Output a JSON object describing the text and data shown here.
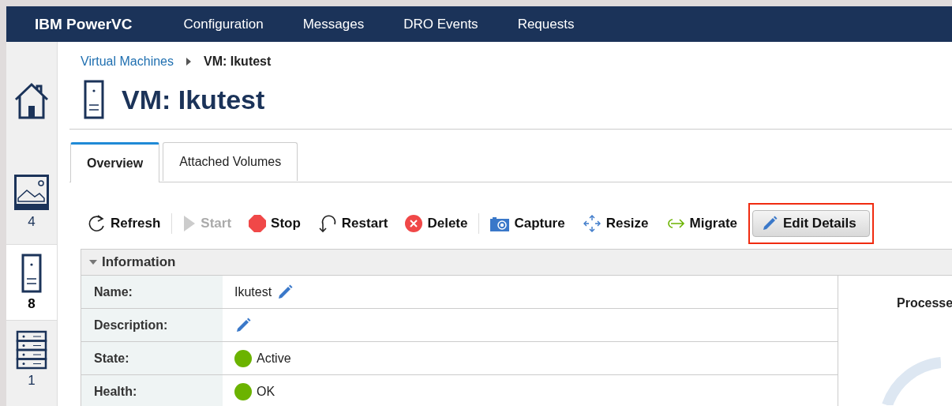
{
  "header": {
    "brand": "IBM PowerVC",
    "nav": [
      {
        "label": "Configuration"
      },
      {
        "label": "Messages"
      },
      {
        "label": "DRO Events"
      },
      {
        "label": "Requests"
      }
    ]
  },
  "sidebar": {
    "items": [
      {
        "kind": "home",
        "selected": false
      },
      {
        "kind": "images",
        "count": "4",
        "selected": false
      },
      {
        "kind": "vms",
        "count": "8",
        "selected": true
      },
      {
        "kind": "hosts",
        "count": "1",
        "selected": false
      }
    ]
  },
  "breadcrumb": {
    "parent": "Virtual Machines",
    "current": "VM: Ikutest"
  },
  "title": "VM: Ikutest",
  "tabs": [
    {
      "label": "Overview",
      "selected": true
    },
    {
      "label": "Attached Volumes",
      "selected": false
    }
  ],
  "toolbar": [
    [
      {
        "kind": "refresh",
        "label": "Refresh",
        "disabled": false,
        "highlighted": false
      }
    ],
    [
      {
        "kind": "start",
        "label": "Start",
        "disabled": true,
        "highlighted": false
      },
      {
        "kind": "stop",
        "label": "Stop",
        "disabled": false,
        "highlighted": false
      },
      {
        "kind": "restart",
        "label": "Restart",
        "disabled": false,
        "highlighted": false
      },
      {
        "kind": "delete",
        "label": "Delete",
        "disabled": false,
        "highlighted": false
      }
    ],
    [
      {
        "kind": "capture",
        "label": "Capture",
        "disabled": false,
        "highlighted": false
      },
      {
        "kind": "resize",
        "label": "Resize",
        "disabled": false,
        "highlighted": false
      },
      {
        "kind": "migrate",
        "label": "Migrate",
        "disabled": false,
        "highlighted": false
      },
      {
        "kind": "edit",
        "label": "Edit Details",
        "disabled": false,
        "highlighted": true
      }
    ]
  ],
  "information": {
    "title": "Information",
    "expanded": true,
    "rows": [
      {
        "kind": "text",
        "label": "Name:",
        "value": "Ikutest",
        "editable": true
      },
      {
        "kind": "text",
        "label": "Description:",
        "editable": true
      },
      {
        "kind": "status",
        "label": "State:",
        "value": "Active",
        "color": "#6bb300",
        "editable": false
      },
      {
        "kind": "status",
        "label": "Health:",
        "value": "OK",
        "color": "#6bb300",
        "editable": false
      }
    ]
  },
  "processor_panel": {
    "title": "Processe"
  }
}
